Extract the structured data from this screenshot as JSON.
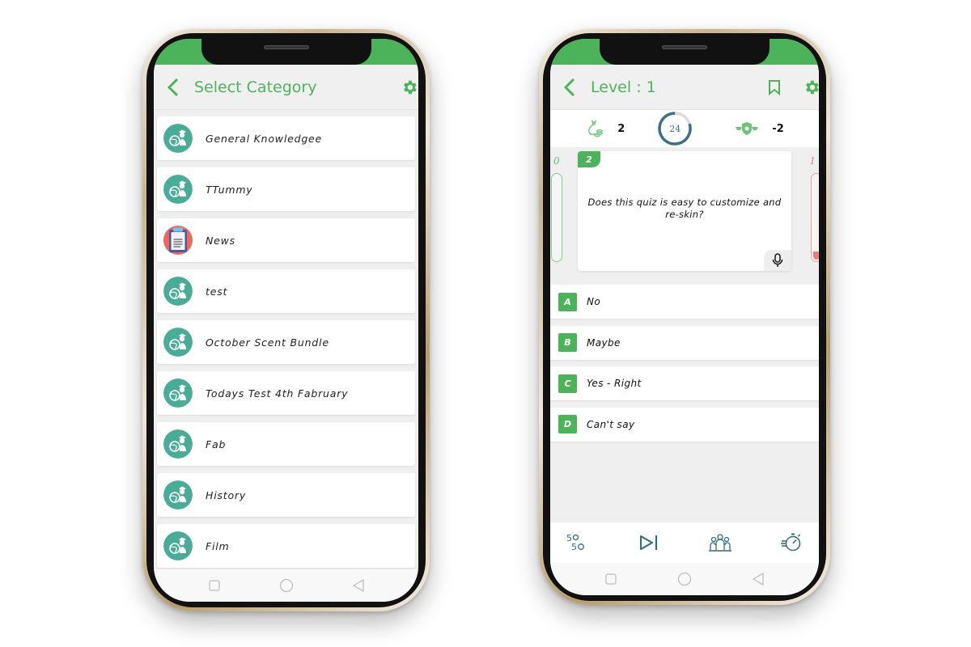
{
  "colors": {
    "brand_green": "#4db35a",
    "teal_icon": "#4aab99",
    "lifeline_blue": "#2f6c84",
    "wrong_red": "#f07b7b",
    "screen_bg": "#efefef"
  },
  "category_screen": {
    "title": "Select Category",
    "back_icon": "chevron-left-icon",
    "settings_icon": "gear-icon",
    "categories": [
      {
        "label": "General Knowledgee",
        "icon": "globe-graduate-icon"
      },
      {
        "label": "TTummy",
        "icon": "globe-graduate-icon"
      },
      {
        "label": "News",
        "icon": "clipboard-news-icon"
      },
      {
        "label": "test",
        "icon": "globe-graduate-icon"
      },
      {
        "label": "October Scent Bundle",
        "icon": "globe-graduate-icon"
      },
      {
        "label": "Todays Test 4th Fabruary",
        "icon": "globe-graduate-icon"
      },
      {
        "label": "Fab",
        "icon": "globe-graduate-icon"
      },
      {
        "label": "History",
        "icon": "globe-graduate-icon"
      },
      {
        "label": "Film",
        "icon": "globe-graduate-icon"
      }
    ],
    "nav": [
      "square-recent-icon",
      "circle-home-icon",
      "triangle-back-icon"
    ]
  },
  "quiz_screen": {
    "title": "Level : 1",
    "back_icon": "chevron-left-icon",
    "bookmark_icon": "bookmark-icon",
    "settings_icon": "gear-icon",
    "coins": "2",
    "timer_value": "24",
    "timer_fraction_remaining": 0.8,
    "score": "-2",
    "correct_count": "0",
    "wrong_count": "1",
    "correct_fraction": 0,
    "wrong_fraction": 0.1,
    "question_number": "2",
    "question_text": "Does this quiz is easy to customize and re-skin?",
    "options": [
      {
        "letter": "A",
        "text": "No"
      },
      {
        "letter": "B",
        "text": "Maybe"
      },
      {
        "letter": "C",
        "text": "Yes - Right"
      },
      {
        "letter": "D",
        "text": "Can't say"
      }
    ],
    "lifelines": [
      {
        "name": "fifty-fifty",
        "label": "50/50"
      },
      {
        "name": "skip",
        "label": "Skip question"
      },
      {
        "name": "audience-poll",
        "label": "Audience poll"
      },
      {
        "name": "reset-timer",
        "label": "Reset timer"
      }
    ],
    "nav": [
      "square-recent-icon",
      "circle-home-icon",
      "triangle-back-icon"
    ]
  }
}
